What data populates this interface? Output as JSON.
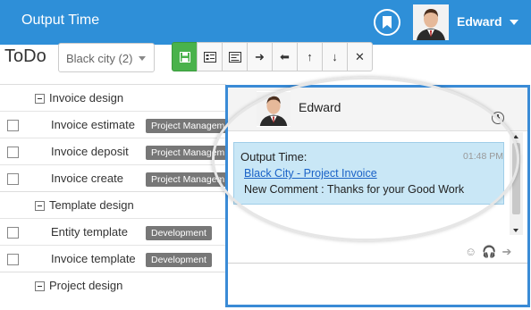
{
  "header": {
    "app_title": "Output Time",
    "user_name": "Edward",
    "bookmark_icon": "bookmark-icon",
    "brand_color": "#2e8fd8"
  },
  "toolbar": {
    "page_title": "ToDo",
    "city_select": "Black city (2)",
    "buttons": [
      {
        "name": "save-icon",
        "glyph": "💾"
      },
      {
        "name": "list-detail-icon",
        "glyph": "☰"
      },
      {
        "name": "list-form-icon",
        "glyph": "▤"
      },
      {
        "name": "arrow-right-icon",
        "glyph": "➜"
      },
      {
        "name": "arrow-left-icon",
        "glyph": "⬅"
      },
      {
        "name": "arrow-up-icon",
        "glyph": "↑"
      },
      {
        "name": "arrow-down-icon",
        "glyph": "↓"
      },
      {
        "name": "close-icon",
        "glyph": "✕"
      }
    ]
  },
  "list": [
    {
      "type": "group",
      "label": "Invoice design"
    },
    {
      "type": "item",
      "label": "Invoice estimate",
      "tag": "Project Managem"
    },
    {
      "type": "item",
      "label": "Invoice deposit",
      "tag": "Project Managem"
    },
    {
      "type": "item",
      "label": "Invoice create",
      "tag": "Project Managem"
    },
    {
      "type": "group",
      "label": "Template design"
    },
    {
      "type": "item",
      "label": "Entity template",
      "tag": "Development"
    },
    {
      "type": "item",
      "label": "Invoice template",
      "tag": "Development"
    },
    {
      "type": "group",
      "label": "Project design"
    }
  ],
  "chat": {
    "user_name": "Edward",
    "message_title": "Output Time:",
    "message_time": "01:48 PM",
    "link_text": "Black City - Project Invoice",
    "body_text": "New Comment : Thanks for your Good Work",
    "footer_icons": [
      "emoji-icon",
      "headset-icon",
      "forward-icon"
    ]
  }
}
